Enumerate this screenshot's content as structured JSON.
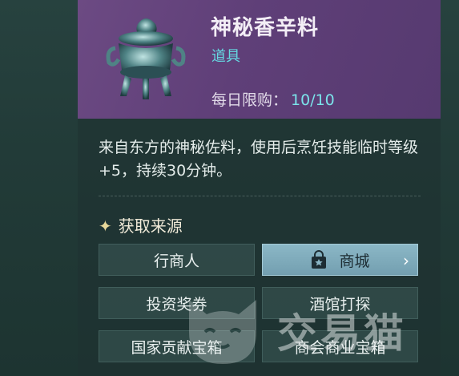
{
  "item": {
    "name": "神秘香辛料",
    "type": "道具",
    "limit_label": "每日限购：",
    "limit_value": "10/10",
    "icon": "incense-burner-icon",
    "description": "来自东方的神秘佐料，使用后烹饪技能临时等级+5，持续30分钟。"
  },
  "sources": {
    "title": "获取来源",
    "title_icon": "star-icon",
    "buttons": [
      {
        "label": "行商人"
      },
      {
        "label": "商城",
        "icon": "shop-bag-icon"
      },
      {
        "label": "投资奖券"
      },
      {
        "label": "酒馆打探"
      },
      {
        "label": "国家贡献宝箱"
      },
      {
        "label": "商会商业宝箱"
      }
    ]
  },
  "watermark": {
    "text": "交易猫"
  },
  "colors": {
    "header": "#5f3f78",
    "accent": "#65d9e2",
    "active_button": "#7fabbb"
  }
}
